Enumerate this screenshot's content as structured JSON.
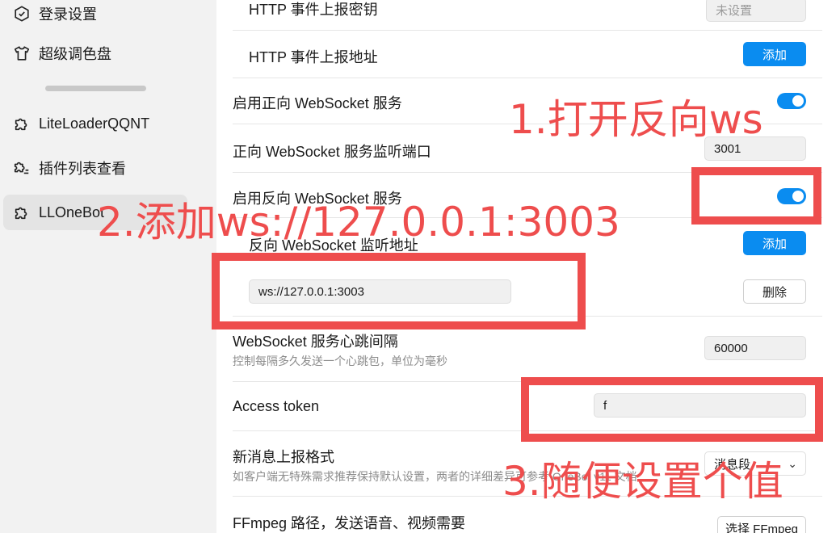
{
  "sidebar": {
    "items": [
      {
        "label": "登录设置",
        "icon": "hexagon-check-icon"
      },
      {
        "label": "超级调色盘",
        "icon": "tshirt-icon"
      },
      {
        "label": "LiteLoaderQQNT",
        "icon": "puzzle-icon"
      },
      {
        "label": "插件列表查看",
        "icon": "puzzle-list-icon"
      },
      {
        "label": "LLOneBot",
        "icon": "puzzle-icon"
      }
    ]
  },
  "settings": {
    "http_secret": {
      "label": "HTTP 事件上报密钥",
      "placeholder": "未设置"
    },
    "http_report_url": {
      "label": "HTTP 事件上报地址",
      "button": "添加"
    },
    "forward_ws_enable": {
      "label": "启用正向 WebSocket 服务"
    },
    "forward_ws_port": {
      "label": "正向 WebSocket 服务监听端口",
      "value": "3001"
    },
    "reverse_ws_enable": {
      "label": "启用反向 WebSocket 服务"
    },
    "reverse_ws_url": {
      "label": "反向 WebSocket 监听地址",
      "button": "添加"
    },
    "reverse_ws_entry": {
      "value": "ws://127.0.0.1:3003",
      "button": "删除"
    },
    "heartbeat": {
      "label": "WebSocket 服务心跳间隔",
      "desc": "控制每隔多久发送一个心跳包，单位为毫秒",
      "value": "60000"
    },
    "access_token": {
      "label": "Access token",
      "value": "f"
    },
    "msg_format": {
      "label": "新消息上报格式",
      "desc": "如客户端无特殊需求推荐保持默认设置，两者的详细差异可参考 OneBot v11 文档",
      "value": "消息段"
    },
    "ffmpeg": {
      "label": "FFmpeg 路径，发送语音、视频需要",
      "button": "选择 FFmpeg"
    }
  },
  "annotations": {
    "step1": "1.打开反向ws",
    "step2": "2.添加ws://127.0.0.1:3003",
    "step3": "3.随便设置个值",
    "color": "#ee4d4d"
  },
  "colors": {
    "accent": "#0a8cf0"
  }
}
